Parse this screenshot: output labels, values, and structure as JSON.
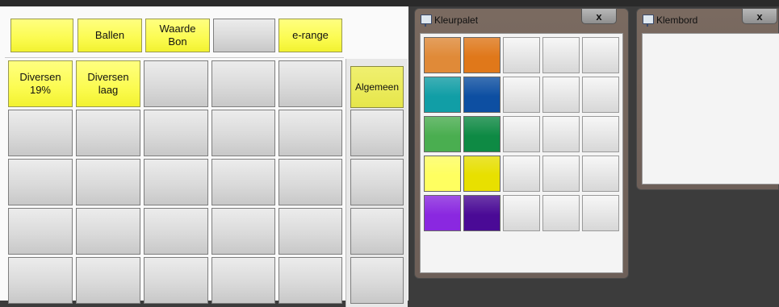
{
  "buttons": {
    "top_row": [
      "",
      "Ballen",
      "Waarde\nBon",
      "",
      "e-range"
    ],
    "row1": [
      "Diversen\n19%",
      "Diversen\nlaag",
      "",
      "",
      ""
    ],
    "side": "Algemeen"
  },
  "palette_window": {
    "title": "Kleurpalet",
    "close": "x",
    "colors": [
      [
        "#e08a38",
        "#e0781a"
      ],
      [
        "#119ea6",
        "#0d4fa2"
      ],
      [
        "#4aae50",
        "#0e8a44"
      ],
      [
        "#ffff60",
        "#e8e000"
      ],
      [
        "#8a28e0",
        "#4a0a96"
      ]
    ]
  },
  "clipboard_window": {
    "title": "Klembord",
    "close": "x"
  }
}
